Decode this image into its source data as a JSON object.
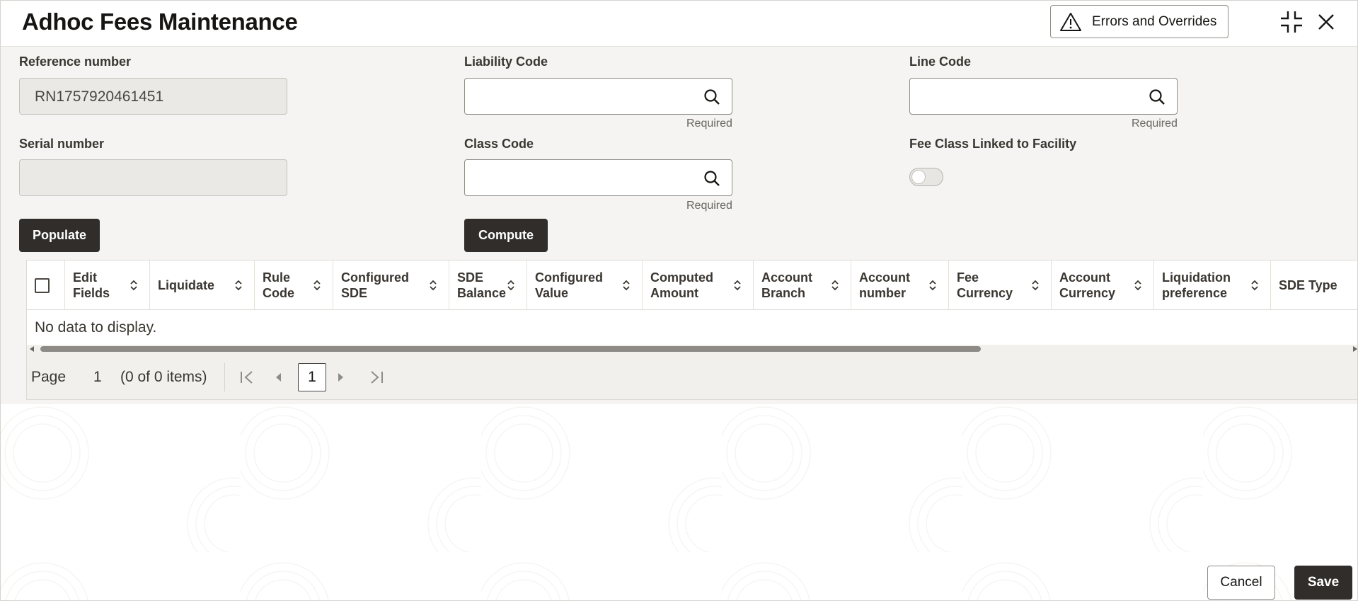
{
  "header": {
    "title": "Adhoc Fees Maintenance",
    "errors_button": "Errors and Overrides",
    "icons": [
      "warning-icon",
      "compress-icon",
      "close-icon"
    ]
  },
  "form": {
    "reference_number": {
      "label": "Reference number",
      "value": "RN1757920461451"
    },
    "liability_code": {
      "label": "Liability Code",
      "value": "",
      "hint": "Required"
    },
    "line_code": {
      "label": "Line Code",
      "value": "",
      "hint": "Required"
    },
    "serial_number": {
      "label": "Serial number",
      "value": ""
    },
    "class_code": {
      "label": "Class Code",
      "value": "",
      "hint": "Required"
    },
    "fee_class_linked": {
      "label": "Fee Class Linked to Facility",
      "on": false
    },
    "populate_button": "Populate",
    "compute_button": "Compute"
  },
  "table": {
    "columns": [
      "Edit Fields",
      "Liquidate",
      "Rule Code",
      "Configured SDE",
      "SDE Balance",
      "Configured Value",
      "Computed Amount",
      "Account Branch",
      "Account number",
      "Fee Currency",
      "Account Currency",
      "Liquidation preference",
      "SDE Type"
    ],
    "columns_display": [
      [
        "Edit",
        "Fields"
      ],
      [
        "Liquidate",
        ""
      ],
      [
        "Rule",
        "Code"
      ],
      [
        "Configured",
        "SDE"
      ],
      [
        "SDE",
        "Balance"
      ],
      [
        "Configured",
        "Value"
      ],
      [
        "Computed",
        "Amount"
      ],
      [
        "Account",
        "Branch"
      ],
      [
        "Account",
        "number"
      ],
      [
        "Fee",
        "Currency"
      ],
      [
        "Account",
        "Currency"
      ],
      [
        "Liquidation",
        "preference"
      ],
      [
        "SDE Type",
        ""
      ]
    ],
    "empty_message": "No data to display.",
    "pagination": {
      "page_label": "Page",
      "page_value": "1",
      "summary": "(0 of 0 items)",
      "current_page": "1"
    }
  },
  "footer": {
    "cancel_button": "Cancel",
    "save_button": "Save"
  },
  "colors": {
    "dark_button": "#312d2a",
    "panel_bg": "#f5f4f2",
    "readonly_field_bg": "#ebe9e6"
  }
}
